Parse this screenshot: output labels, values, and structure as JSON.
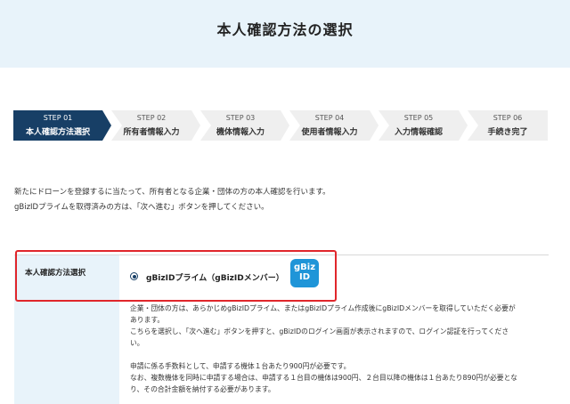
{
  "header": {
    "title": "本人確認方法の選択"
  },
  "steps": [
    {
      "num": "STEP 01",
      "label": "本人確認方法選択",
      "active": true
    },
    {
      "num": "STEP 02",
      "label": "所有者情報入力",
      "active": false
    },
    {
      "num": "STEP 03",
      "label": "機体情報入力",
      "active": false
    },
    {
      "num": "STEP 04",
      "label": "使用者情報入力",
      "active": false
    },
    {
      "num": "STEP 05",
      "label": "入力情報確認",
      "active": false
    },
    {
      "num": "STEP 06",
      "label": "手続き完了",
      "active": false
    }
  ],
  "intro": {
    "line1": "新たにドローンを登録するに当たって、所有者となる企業・団体の方の本人確認を行います。",
    "line2": "gBizIDプライムを取得済みの方は、「次へ進む」ボタンを押してください。"
  },
  "form": {
    "row_label": "本人確認方法選択",
    "option_label": "gBizIDプライム（gBizIDメンバー）",
    "logo_line1": "gBiz",
    "logo_line2": "ID",
    "desc1": "企業・団体の方は、あらかじめgBizIDプライム、またはgBizIDプライム作成後にgBizIDメンバーを取得していただく必要が",
    "desc2": "あります。",
    "desc3": "こちらを選択し、「次へ進む」ボタンを押すと、gBizIDのログイン画面が表示されますので、ログイン認証を行ってくださ",
    "desc4": "い。",
    "desc5": "申請に係る手数料として、申請する機体１台あたり900円が必要です。",
    "desc6": "なお、複数機体を同時に申請する場合は、申請する１台目の機体は900円、２台目以降の機体は１台あたり890円が必要とな",
    "desc7": "り、その合計金額を納付する必要があります。"
  },
  "colors": {
    "active_step": "#173f66",
    "header_bg": "#e8f3fa",
    "highlight": "#e0262b",
    "logo": "#1f95d8"
  }
}
